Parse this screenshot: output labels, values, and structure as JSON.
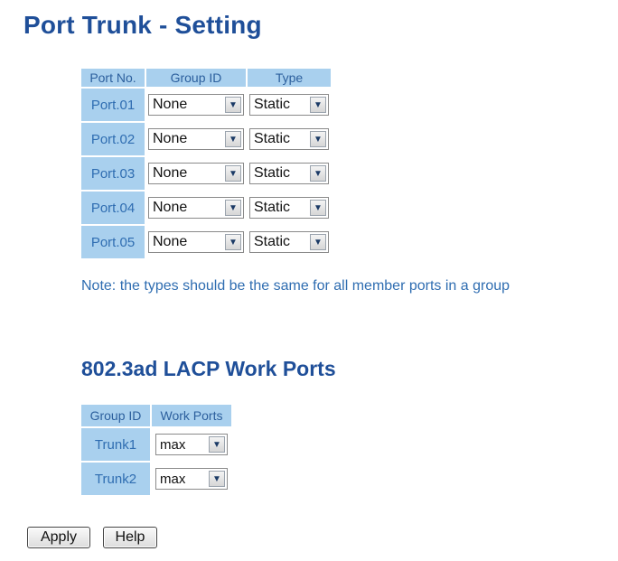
{
  "title": "Port Trunk - Setting",
  "port_table": {
    "headers": [
      "Port No.",
      "Group ID",
      "Type"
    ],
    "rows": [
      {
        "port": "Port.01",
        "group_id": "None",
        "type": "Static"
      },
      {
        "port": "Port.02",
        "group_id": "None",
        "type": "Static"
      },
      {
        "port": "Port.03",
        "group_id": "None",
        "type": "Static"
      },
      {
        "port": "Port.04",
        "group_id": "None",
        "type": "Static"
      },
      {
        "port": "Port.05",
        "group_id": "None",
        "type": "Static"
      }
    ]
  },
  "note": "Note: the types should be the same for all member ports in a group",
  "lacp": {
    "title": "802.3ad LACP Work Ports",
    "headers": [
      "Group ID",
      "Work Ports"
    ],
    "rows": [
      {
        "group": "Trunk1",
        "work_ports": "max"
      },
      {
        "group": "Trunk2",
        "work_ports": "max"
      }
    ]
  },
  "buttons": {
    "apply": "Apply",
    "help": "Help"
  },
  "icons": {
    "dropdown": "chevron-down-icon"
  },
  "colors": {
    "title": "#1f4f99",
    "header_bg": "#a9d0ee",
    "text_blue": "#2f6db1"
  }
}
